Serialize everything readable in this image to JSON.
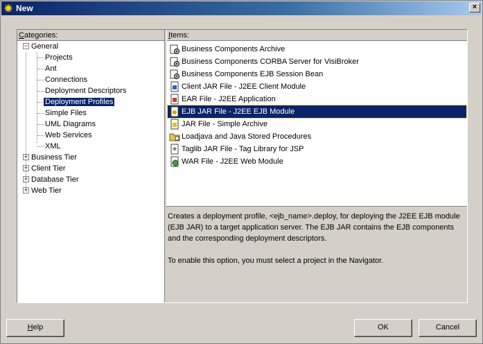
{
  "window": {
    "title": "New",
    "close_label": "×"
  },
  "categories": {
    "header_prefix": "C",
    "header_rest": "ategories:",
    "nodes": [
      {
        "label": "General",
        "expander": "−"
      },
      {
        "label": "Projects"
      },
      {
        "label": "Ant"
      },
      {
        "label": "Connections"
      },
      {
        "label": "Deployment Descriptors"
      },
      {
        "label": "Deployment Profiles"
      },
      {
        "label": "Simple Files"
      },
      {
        "label": "UML Diagrams"
      },
      {
        "label": "Web Services"
      },
      {
        "label": "XML"
      },
      {
        "label": "Business Tier",
        "expander": "+"
      },
      {
        "label": "Client Tier",
        "expander": "+"
      },
      {
        "label": "Database Tier",
        "expander": "+"
      },
      {
        "label": "Web Tier",
        "expander": "+"
      }
    ]
  },
  "items": {
    "header_prefix": "I",
    "header_rest": "tems:",
    "list": [
      {
        "label": "Business Components Archive",
        "icon": "archive-gear-icon"
      },
      {
        "label": "Business Components CORBA Server for VisiBroker",
        "icon": "archive-gear-icon"
      },
      {
        "label": "Business Components EJB Session Bean",
        "icon": "archive-gear-icon"
      },
      {
        "label": "Client JAR File - J2EE Client Module",
        "icon": "jar-file-icon"
      },
      {
        "label": "EAR File - J2EE Application",
        "icon": "ear-file-icon"
      },
      {
        "label": "EJB JAR File - J2EE EJB Module",
        "icon": "ejb-jar-icon"
      },
      {
        "label": "JAR File - Simple Archive",
        "icon": "jar-file-icon"
      },
      {
        "label": "Loadjava and Java Stored Procedures",
        "icon": "loadjava-icon"
      },
      {
        "label": "Taglib JAR File - Tag Library for JSP",
        "icon": "taglib-icon"
      },
      {
        "label": "WAR File - J2EE Web Module",
        "icon": "war-file-icon"
      }
    ]
  },
  "description": {
    "paragraph1": "Creates a deployment profile, <ejb_name>.deploy, for deploying the J2EE EJB module (EJB JAR) to a target application server.  The EJB JAR contains the EJB components and the corresponding deployment descriptors.",
    "paragraph2": "To enable this option, you must select a project in the Navigator."
  },
  "buttons": {
    "help_mnemonic": "H",
    "help_rest": "elp",
    "ok": "OK",
    "cancel": "Cancel"
  },
  "colors": {
    "selection": "#0a246a",
    "face": "#d4d0c8",
    "title_start": "#0a246a"
  }
}
